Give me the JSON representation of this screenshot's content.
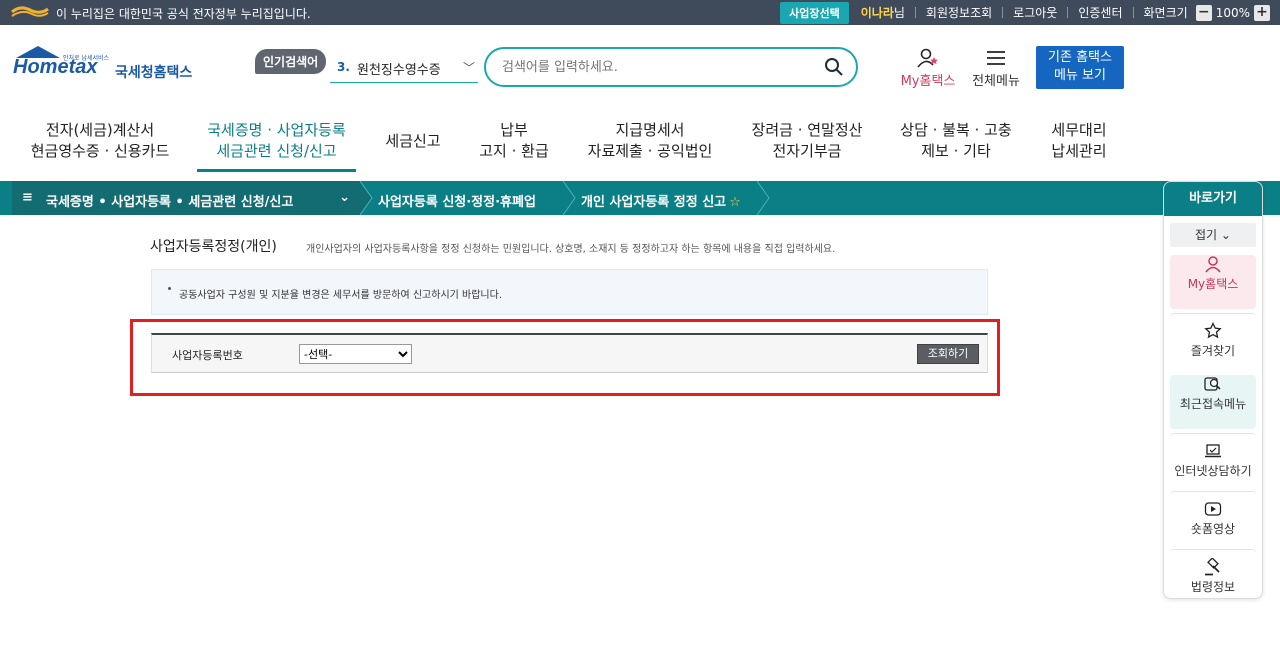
{
  "gov_bar": {
    "notice": "이 누리집은 대한민국 공식 전자정부 누리집입니다.",
    "business_select": "사업장선택",
    "user_name": "이나라",
    "user_suffix": "님",
    "links": [
      "회원정보조회",
      "로그아웃",
      "인증센터",
      "화면크기"
    ],
    "zoom": "100%"
  },
  "header": {
    "logo_sub": "안처로 납세서비스",
    "logo_name": "Hometax",
    "logo_kr": "국세청홈택스",
    "popular_tag": "인기검색어",
    "popular_rank": "3.",
    "popular_keyword": "원천징수영수증",
    "search_placeholder": "검색어를 입력하세요.",
    "my_home": "My홈택스",
    "all_menu": "전체메뉴",
    "old_menu_line1": "기존 홈택스",
    "old_menu_line2": "메뉴 보기"
  },
  "gnb": [
    {
      "l1": "전자(세금)계산서",
      "l2": "현금영수증 · 신용카드"
    },
    {
      "l1": "국세증명 · 사업자등록",
      "l2": "세금관련 신청/신고"
    },
    {
      "l1": "세금신고",
      "l2": ""
    },
    {
      "l1": "납부",
      "l2": "고지 · 환급"
    },
    {
      "l1": "지급명세서",
      "l2": "자료제출 · 공익법인"
    },
    {
      "l1": "장려금 · 연말정산",
      "l2": "전자기부금"
    },
    {
      "l1": "상담 · 불복 · 고충",
      "l2": "제보 · 기타"
    },
    {
      "l1": "세무대리",
      "l2": "납세관리"
    }
  ],
  "breadcrumb": {
    "level1": "국세증명 • 사업자등록 • 세금관련 신청/신고",
    "level2": "사업자등록 신청·정정·휴폐업",
    "level3": "개인 사업자등록 정정 신고"
  },
  "content": {
    "title": "사업자등록정정(개인)",
    "description": "개인사업자의 사업자등록사항을 정정 신청하는 민원입니다. 상호명, 소재지 등 정정하고자 하는 항목에 내용을 직접 입력하세요.",
    "notice": "공동사업자 구성원 및 지분율 변경은 세무서를 방문하여 신고하시기 바랍니다.",
    "form_label": "사업자등록번호",
    "select_value": "-선택-",
    "lookup_button": "조회하기"
  },
  "quick_menu": {
    "title": "바로가기",
    "fold": "접기",
    "items": [
      "My홈택스",
      "즐겨찾기",
      "최근접속메뉴",
      "인터넷상담하기",
      "숏폼영상",
      "법령정보"
    ]
  }
}
